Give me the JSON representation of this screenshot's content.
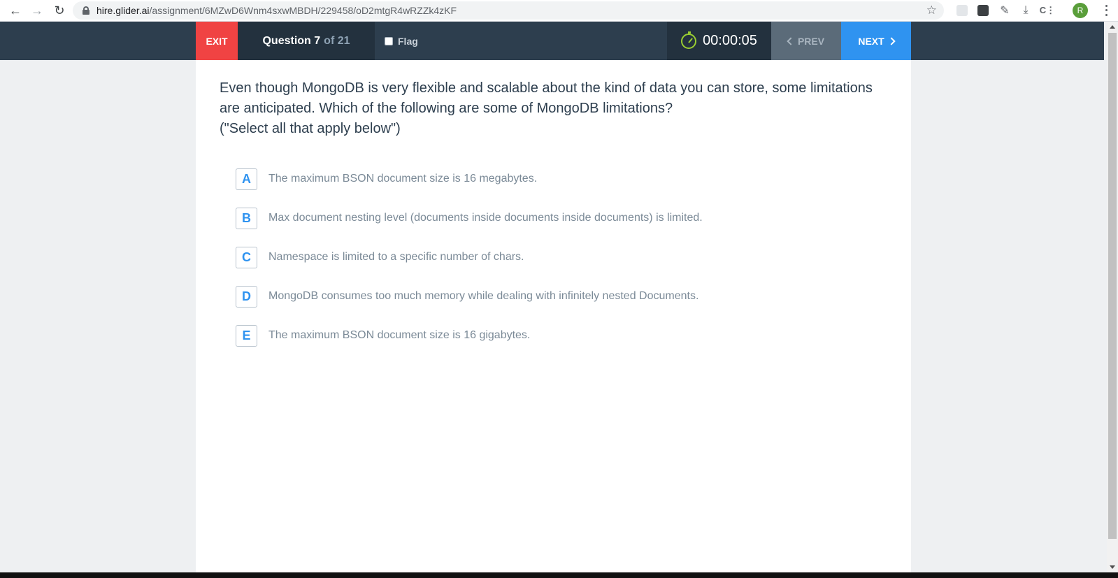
{
  "browser": {
    "url_host": "hire.glider.ai",
    "url_path": "/assignment/6MZwD6Wnm4sxwMBDH/229458/oD2mtgR4wRZZk4zKF",
    "profile_initial": "R"
  },
  "header": {
    "exit_label": "EXIT",
    "question_label": "Question 7",
    "question_of": "of 21",
    "flag_label": "Flag",
    "timer": "00:00:05",
    "prev_label": "PREV",
    "next_label": "NEXT"
  },
  "question": {
    "text": "Even though MongoDB is very flexible and scalable about the kind of data you can store, some limitations are anticipated. Which of the following are some of MongoDB limitations?",
    "hint": "(\"Select all that apply below\")"
  },
  "options": [
    {
      "key": "A",
      "text": "The maximum BSON document size is 16 megabytes."
    },
    {
      "key": "B",
      "text": "Max document nesting level (documents inside documents inside documents) is limited."
    },
    {
      "key": "C",
      "text": "Namespace is limited to a specific number of chars."
    },
    {
      "key": "D",
      "text": "MongoDB consumes too much memory while dealing with infinitely nested Documents."
    },
    {
      "key": "E",
      "text": "The maximum BSON document size is 16 gigabytes."
    }
  ],
  "colors": {
    "exit": "#f04343",
    "next": "#2f93f0",
    "appbar": "#2d3e4e"
  }
}
